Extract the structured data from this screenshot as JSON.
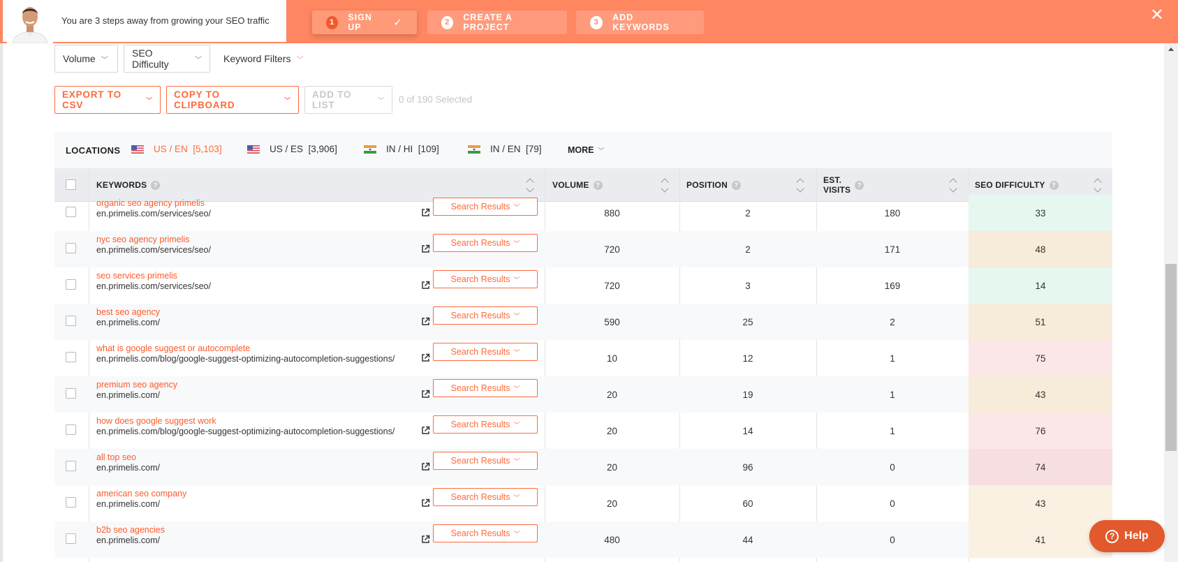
{
  "banner": {
    "message": "You are 3 steps away from growing your SEO traffic",
    "steps": [
      {
        "num": "1",
        "label": "SIGN UP"
      },
      {
        "num": "2",
        "label": "CREATE A PROJECT"
      },
      {
        "num": "3",
        "label": "ADD KEYWORDS"
      }
    ],
    "close_label": "✕"
  },
  "filters": {
    "volume": "Volume",
    "seo_difficulty": "SEO Difficulty",
    "keyword_filters": "Keyword Filters"
  },
  "actions": {
    "export": "EXPORT TO CSV",
    "copy": "COPY TO CLIPBOARD",
    "add_to_list": "ADD TO LIST",
    "selected": "0 of 190 Selected"
  },
  "locations": {
    "title": "LOCATIONS",
    "items": [
      {
        "label": "US / EN",
        "count": "[5,103]",
        "flag": "us-flag",
        "active": true
      },
      {
        "label": "US / ES",
        "count": "[3,906]",
        "flag": "us-flag",
        "active": false
      },
      {
        "label": "IN / HI",
        "count": "[109]",
        "flag": "in-flag",
        "active": false
      },
      {
        "label": "IN / EN",
        "count": "[79]",
        "flag": "in-flag",
        "active": false
      }
    ],
    "more": "MORE"
  },
  "table": {
    "headers": {
      "keywords": "KEYWORDS",
      "volume": "VOLUME",
      "position": "POSITION",
      "est_visits_1": "EST.",
      "est_visits_2": "VISITS",
      "seo_difficulty": "SEO DIFFICULTY"
    },
    "search_results_label": "Search Results",
    "rows": [
      {
        "keyword": "organic seo agency primelis",
        "url": "en.primelis.com/services/seo/",
        "volume": "880",
        "position": "2",
        "visits": "180",
        "sd": "33",
        "sd_color": "#e6f7f0"
      },
      {
        "keyword": "nyc seo agency primelis",
        "url": "en.primelis.com/services/seo/",
        "volume": "720",
        "position": "2",
        "visits": "171",
        "sd": "48",
        "sd_color": "#f7ebd9"
      },
      {
        "keyword": "seo services primelis",
        "url": "en.primelis.com/services/seo/",
        "volume": "720",
        "position": "3",
        "visits": "169",
        "sd": "14",
        "sd_color": "#e6f7f0"
      },
      {
        "keyword": "best seo agency",
        "url": "en.primelis.com/",
        "volume": "590",
        "position": "25",
        "visits": "2",
        "sd": "51",
        "sd_color": "#f7ebd9"
      },
      {
        "keyword": "what is google suggest or autocomplete",
        "url": "en.primelis.com/blog/google-suggest-optimizing-autocompletion-suggestions/",
        "volume": "10",
        "position": "12",
        "visits": "1",
        "sd": "75",
        "sd_color": "#fbe6e8"
      },
      {
        "keyword": "premium seo agency",
        "url": "en.primelis.com/",
        "volume": "20",
        "position": "19",
        "visits": "1",
        "sd": "43",
        "sd_color": "#f7ebd9"
      },
      {
        "keyword": "how does google suggest work",
        "url": "en.primelis.com/blog/google-suggest-optimizing-autocompletion-suggestions/",
        "volume": "20",
        "position": "14",
        "visits": "1",
        "sd": "76",
        "sd_color": "#fbe6e8"
      },
      {
        "keyword": "all top seo",
        "url": "en.primelis.com/",
        "volume": "20",
        "position": "96",
        "visits": "0",
        "sd": "74",
        "sd_color": "#f7dfe1"
      },
      {
        "keyword": "american seo company",
        "url": "en.primelis.com/",
        "volume": "20",
        "position": "60",
        "visits": "0",
        "sd": "43",
        "sd_color": "#faf1e2"
      },
      {
        "keyword": "b2b seo agencies",
        "url": "en.primelis.com/",
        "volume": "480",
        "position": "44",
        "visits": "0",
        "sd": "41",
        "sd_color": "#faf1e2"
      }
    ]
  },
  "help": {
    "label": "Help"
  }
}
